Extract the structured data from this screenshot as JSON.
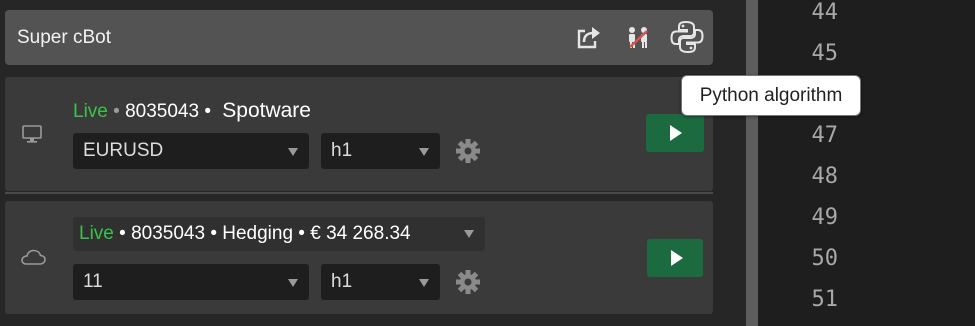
{
  "header": {
    "title": "Super cBot",
    "icons": [
      "share-icon",
      "people-icon",
      "python-icon"
    ]
  },
  "instances": [
    {
      "environment_icon": "monitor-icon",
      "live_label": "Live",
      "account_text": "8035043 •",
      "broker": "Spotware",
      "symbol": "EURUSD",
      "timeframe": "h1",
      "run_icon": "play-icon"
    },
    {
      "environment_icon": "cloud-icon",
      "live_label": "Live",
      "account_text": "• 8035043 • Hedging • € 34 268.34",
      "symbol": "11",
      "timeframe": "h1",
      "run_icon": "play-icon"
    }
  ],
  "tooltip": {
    "text": "Python algorithm"
  },
  "code_panel": {
    "line_numbers": [
      "44",
      "45",
      "46",
      "47",
      "48",
      "49",
      "50",
      "51"
    ]
  },
  "colors": {
    "live": "#3ac24a",
    "play_button": "#1c6b40",
    "header_bar": "#535353",
    "card": "#3a3a3a"
  }
}
